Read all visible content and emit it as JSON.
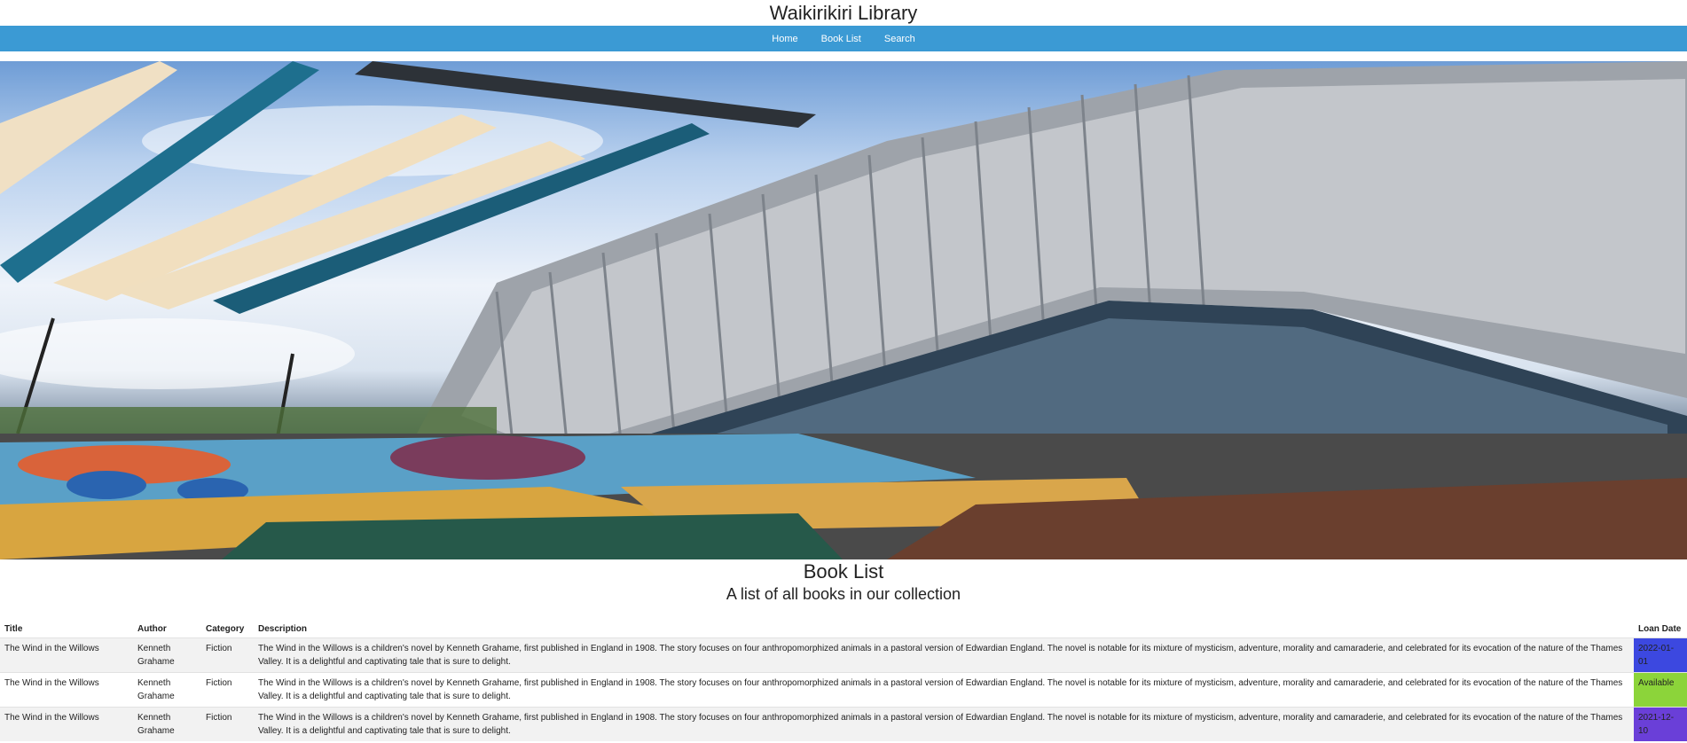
{
  "site": {
    "title": "Waikirikiri Library"
  },
  "nav": {
    "items": [
      "Home",
      "Book List",
      "Search"
    ]
  },
  "main": {
    "heading": "Book List",
    "subheading": "A list of all books in our collection"
  },
  "table": {
    "headers": [
      "Title",
      "Author",
      "Category",
      "Description",
      "Loan Date"
    ],
    "rows": [
      {
        "title": "The Wind in the Willows",
        "author": "Kenneth Grahame",
        "category": "Fiction",
        "description": "The Wind in the Willows is a children's novel by Kenneth Grahame, first published in England in 1908. The story focuses on four anthropomorphized animals in a pastoral version of Edwardian England. The novel is notable for its mixture of mysticism, adventure, morality and camaraderie, and celebrated for its evocation of the nature of the Thames Valley. It is a delightful and captivating tale that is sure to delight.",
        "loan": "2022-01-01",
        "loan_color": "#3c48e0"
      },
      {
        "title": "The Wind in the Willows",
        "author": "Kenneth Grahame",
        "category": "Fiction",
        "description": "The Wind in the Willows is a children's novel by Kenneth Grahame, first published in England in 1908. The story focuses on four anthropomorphized animals in a pastoral version of Edwardian England. The novel is notable for its mixture of mysticism, adventure, morality and camaraderie, and celebrated for its evocation of the nature of the Thames Valley. It is a delightful and captivating tale that is sure to delight.",
        "loan": "Available",
        "loan_color": "#8cd43a"
      },
      {
        "title": "The Wind in the Willows",
        "author": "Kenneth Grahame",
        "category": "Fiction",
        "description": "The Wind in the Willows is a children's novel by Kenneth Grahame, first published in England in 1908. The story focuses on four anthropomorphized animals in a pastoral version of Edwardian England. The novel is notable for its mixture of mysticism, adventure, morality and camaraderie, and celebrated for its evocation of the nature of the Thames Valley. It is a delightful and captivating tale that is sure to delight.",
        "loan": "2021-12-10",
        "loan_color": "#6a3fd8"
      }
    ]
  }
}
